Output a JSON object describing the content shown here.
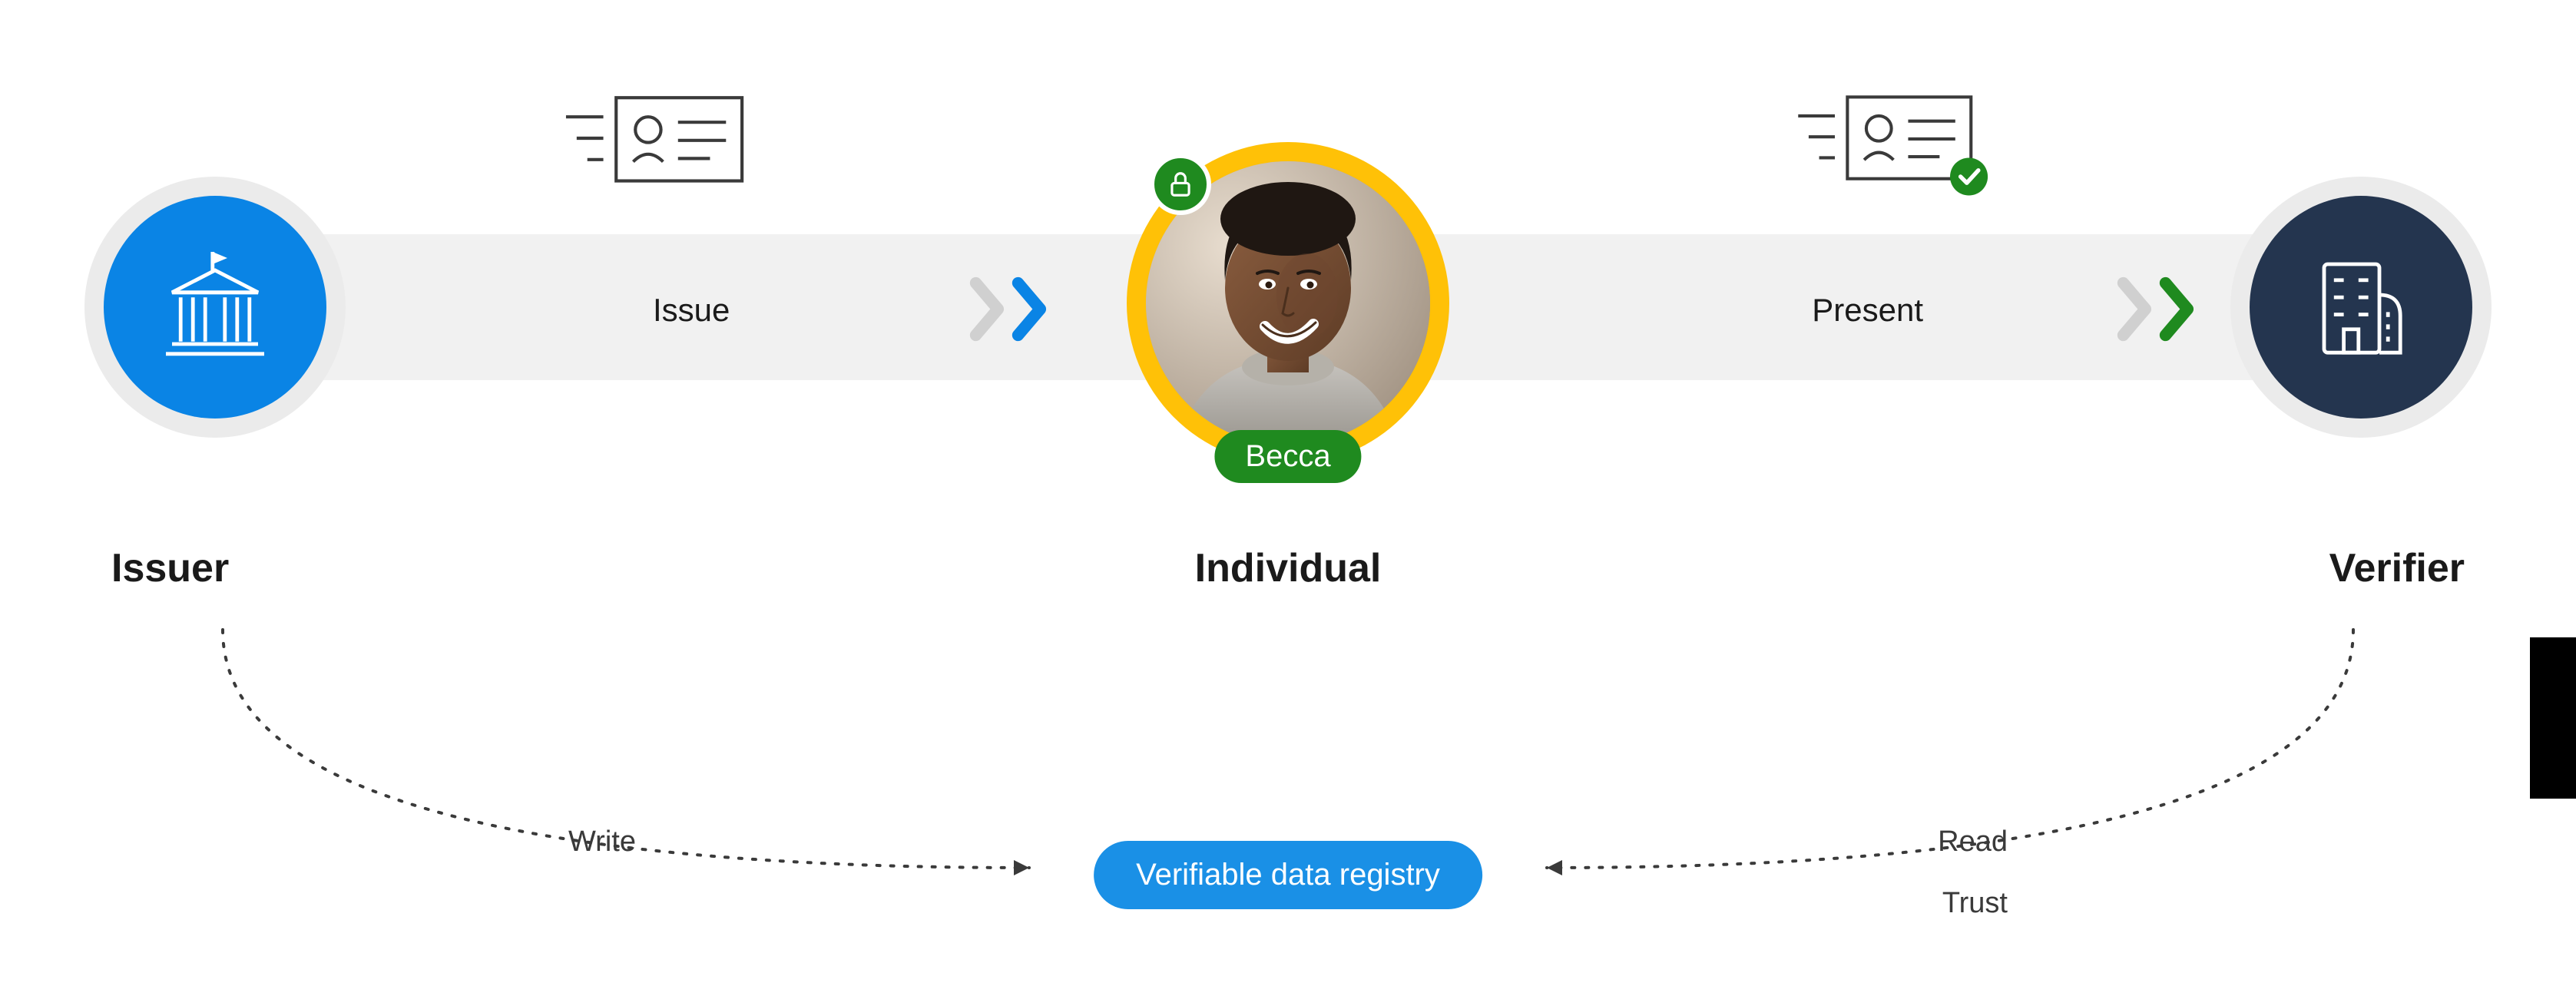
{
  "nodes": {
    "issuer": {
      "label": "Issuer"
    },
    "individual": {
      "label": "Individual",
      "name": "Becca"
    },
    "verifier": {
      "label": "Verifier"
    }
  },
  "flows": {
    "issue": {
      "label": "Issue"
    },
    "present": {
      "label": "Present"
    }
  },
  "registry": {
    "title": "Verifiable data registry",
    "write_label": "Write",
    "read_label": "Read",
    "trust_label": "Trust"
  },
  "colors": {
    "issuer_bg": "#0a84e5",
    "verifier_bg": "#24354f",
    "accent_green": "#1f8a1f",
    "accent_yellow": "#ffc107",
    "registry_blue": "#1a90e6",
    "chevron_blue": "#0a84e5",
    "chevron_green": "#1f8a1f",
    "chevron_grey": "#d0d0d0"
  }
}
